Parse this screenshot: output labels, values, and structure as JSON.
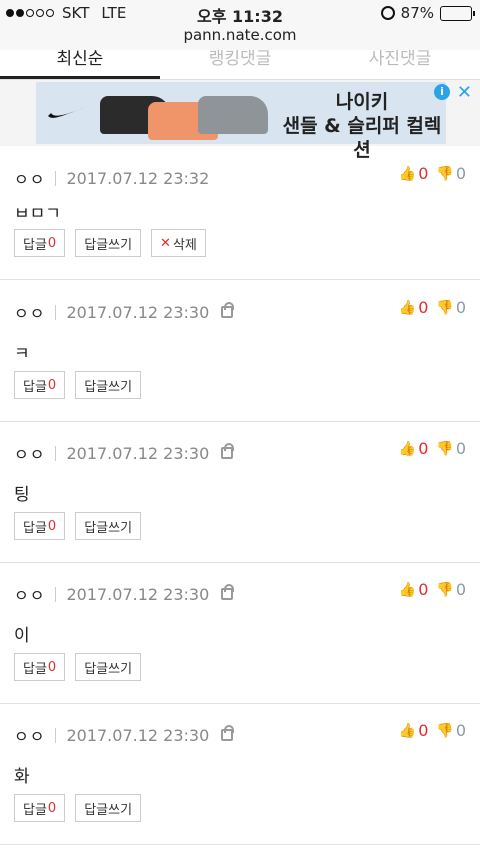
{
  "statusbar": {
    "carrier": "SKT",
    "network": "LTE",
    "time": "오후 11:32",
    "battery": "87%",
    "battery_level": 0.87
  },
  "url": "pann.nate.com",
  "tabs": [
    {
      "label": "최신순",
      "active": true
    },
    {
      "label": "랭킹댓글",
      "active": false
    },
    {
      "label": "사진댓글",
      "active": false
    }
  ],
  "ad": {
    "line1": "나이키",
    "line2": "샌들 & 슬리퍼 컬렉션",
    "info": "i",
    "close": "✕"
  },
  "comments": [
    {
      "author": "ㅇㅇ",
      "date": "2017.07.12 23:32",
      "text": "ㅂㅁㄱ",
      "up": "0",
      "down": "0",
      "reply_label": "답글",
      "reply_count": "0",
      "write_label": "답글쓰기",
      "delete_label": "삭제",
      "locked": false
    },
    {
      "author": "ㅇㅇ",
      "date": "2017.07.12 23:30",
      "text": "ㅋ",
      "up": "0",
      "down": "0",
      "reply_label": "답글",
      "reply_count": "0",
      "write_label": "답글쓰기",
      "locked": true
    },
    {
      "author": "ㅇㅇ",
      "date": "2017.07.12 23:30",
      "text": "팅",
      "up": "0",
      "down": "0",
      "reply_label": "답글",
      "reply_count": "0",
      "write_label": "답글쓰기",
      "locked": true
    },
    {
      "author": "ㅇㅇ",
      "date": "2017.07.12 23:30",
      "text": "이",
      "up": "0",
      "down": "0",
      "reply_label": "답글",
      "reply_count": "0",
      "write_label": "답글쓰기",
      "locked": true
    },
    {
      "author": "ㅇㅇ",
      "date": "2017.07.12 23:30",
      "text": "화",
      "up": "0",
      "down": "0",
      "reply_label": "답글",
      "reply_count": "0",
      "write_label": "답글쓰기",
      "locked": true
    }
  ]
}
